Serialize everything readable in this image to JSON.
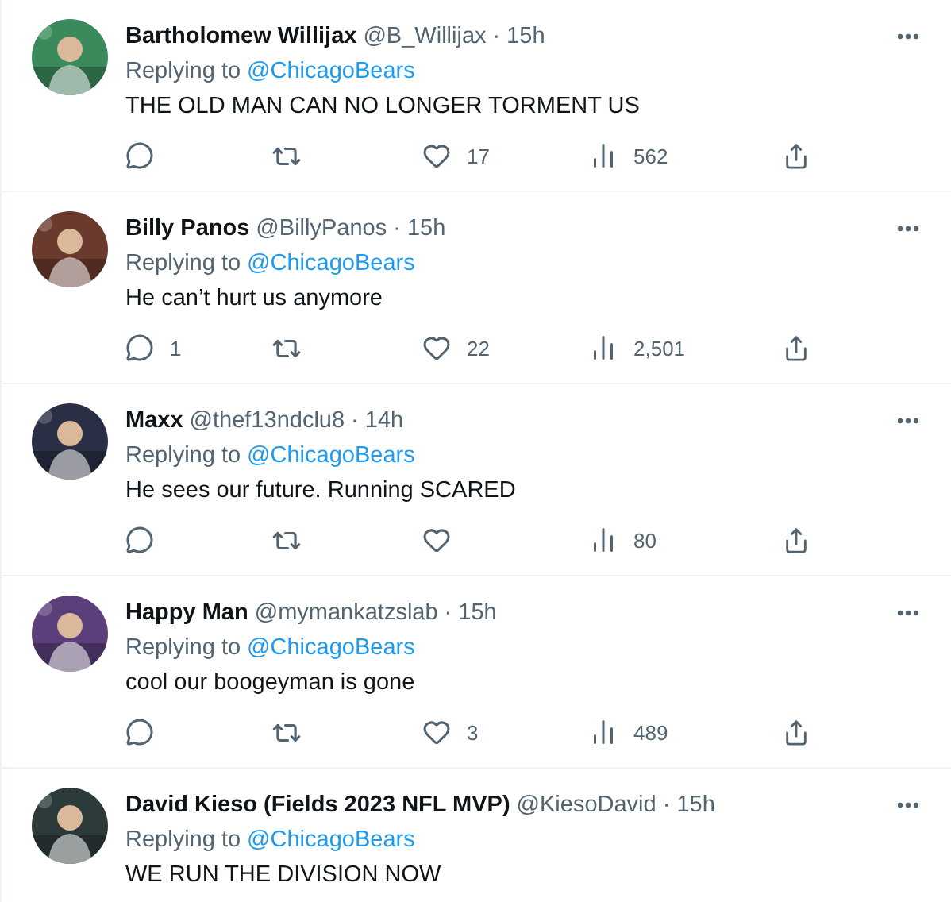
{
  "separator": "·",
  "tweets": [
    {
      "name": "Bartholomew Willijax",
      "handle": "@B_Willijax",
      "time": "15h",
      "replying_label": "Replying to",
      "replying_to": "@ChicagoBears",
      "text": "THE OLD MAN CAN NO LONGER TORMENT US",
      "stats": {
        "likes": "17",
        "views": "562"
      }
    },
    {
      "name": "Billy Panos",
      "handle": "@BillyPanos",
      "time": "15h",
      "replying_label": "Replying to",
      "replying_to": "@ChicagoBears",
      "text": "He can’t hurt us anymore",
      "stats": {
        "replies": "1",
        "likes": "22",
        "views": "2,501"
      }
    },
    {
      "name": "Maxx",
      "handle": "@thef13ndclu8",
      "time": "14h",
      "replying_label": "Replying to",
      "replying_to": "@ChicagoBears",
      "text": "He sees our future. Running SCARED",
      "stats": {
        "views": "80"
      }
    },
    {
      "name": "Happy Man",
      "handle": "@mymankatzslab",
      "time": "15h",
      "replying_label": "Replying to",
      "replying_to": "@ChicagoBears",
      "text": "cool our boogeyman is gone",
      "stats": {
        "likes": "3",
        "views": "489"
      }
    },
    {
      "name": "David Kieso (Fields 2023 NFL MVP)",
      "handle": "@KiesoDavid",
      "time": "15h",
      "replying_label": "Replying to",
      "replying_to": "@ChicagoBears",
      "text": "WE RUN THE DIVISION NOW"
    }
  ]
}
